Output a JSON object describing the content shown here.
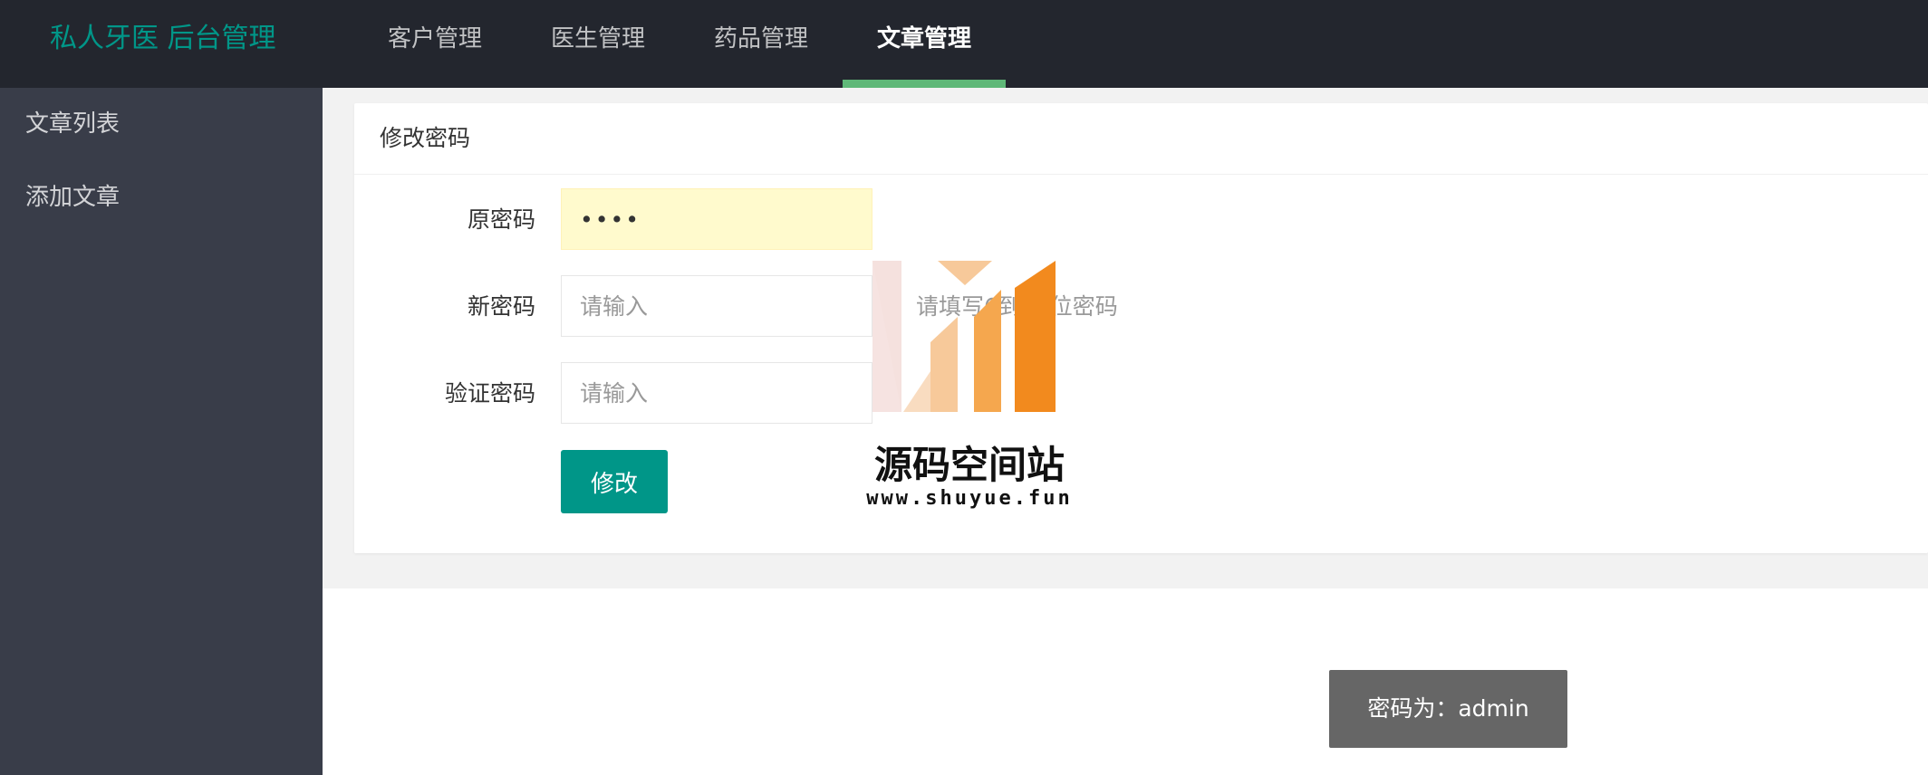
{
  "header": {
    "brand": "私人牙医 后台管理",
    "nav": [
      {
        "label": "客户管理"
      },
      {
        "label": "医生管理"
      },
      {
        "label": "药品管理"
      },
      {
        "label": "文章管理"
      }
    ],
    "active_nav": "文章管理"
  },
  "sidebar": {
    "items": [
      {
        "label": "文章列表"
      },
      {
        "label": "添加文章"
      }
    ]
  },
  "form": {
    "title": "修改密码",
    "old_password": {
      "label": "原密码",
      "value": "••••"
    },
    "new_password": {
      "label": "新密码",
      "placeholder": "请输入",
      "hint": "请填写6到12位密码"
    },
    "confirm_password": {
      "label": "验证密码",
      "placeholder": "请输入"
    },
    "submit_label": "修改"
  },
  "toast": {
    "text": "密码为：admin"
  },
  "watermark": {
    "title": "源码空间站",
    "url": "www.shuyue.fun",
    "icon": "bar-chart-logo"
  },
  "colors": {
    "header_bg": "#23262e",
    "sidebar_bg": "#393d49",
    "brand": "#009688",
    "active_underline": "#5fb878",
    "primary_button": "#009688",
    "toast_bg": "#666666",
    "autofill_bg": "#fffacd"
  }
}
